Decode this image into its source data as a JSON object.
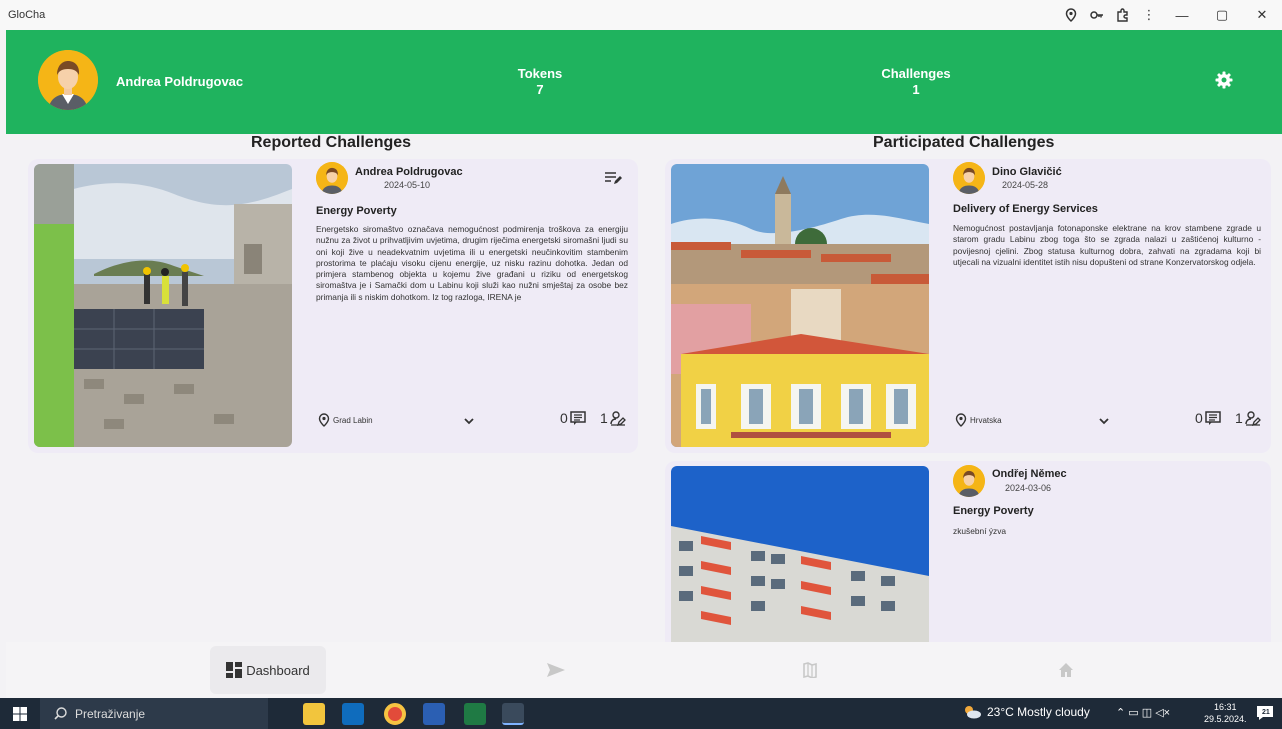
{
  "window": {
    "title": "GloCha",
    "min": "—",
    "max": "▢",
    "close": "✕"
  },
  "header": {
    "user_name": "Andrea Poldrugovac",
    "tokens_label": "Tokens",
    "tokens_value": "7",
    "challenges_label": "Challenges",
    "challenges_value": "1"
  },
  "sections": {
    "reported": "Reported Challenges",
    "participated": "Participated Challenges"
  },
  "reported": [
    {
      "author": "Andrea Poldrugovac",
      "date": "2024-05-10",
      "title": "Energy Poverty",
      "description": "Energetsko siromaštvo označava nemogućnost podmirenja troškova za energiju nužnu za život u prihvatljivim uvjetima, drugim riječima energetski siromašni ljudi su oni koji žive u neadekvatnim uvjetima ili u energetski neučinkovitim stambenim prostorima te plaćaju visoku cijenu energije, uz nisku razinu dohotka. Jedan od primjera stambenog objekta u kojemu žive građani u riziku od energetskog siromaštva je i Samački dom u Labinu koji služi kao nužni smještaj za osobe bez primanja ili s niskim dohotkom. Iz tog razloga, IRENA je",
      "location": "Grad Labin",
      "comments": "0",
      "participants": "1"
    }
  ],
  "participated": [
    {
      "author": "Dino Glavičić",
      "date": "2024-05-28",
      "title": "Delivery of Energy Services",
      "description": "Nemogućnost postavljanja fotonaponske elektrane na krov stambene zgrade u starom gradu Labinu zbog toga što se zgrada nalazi u zaštićenoj kulturno - povijesnoj cjelini. Zbog statusa kulturnog dobra, zahvati na zgradama koji bi utjecali na vizualni identitet istih nisu dopušteni od strane Konzervatorskog odjela.",
      "location": "Hrvatska",
      "comments": "0",
      "participants": "1"
    },
    {
      "author": "Ondřej Němec",
      "date": "2024-03-06",
      "title": "Energy Poverty",
      "description": "zkušební ýzva"
    }
  ],
  "nav": {
    "dashboard": "Dashboard"
  },
  "taskbar": {
    "search_placeholder": "Pretraživanje",
    "weather": "23°C  Mostly cloudy",
    "time": "16:31",
    "date": "29.5.2024.",
    "notif_count": "21"
  },
  "colors": {
    "accent": "#1fb35e",
    "card_bg": "#efebf6",
    "avatar_bg": "#f5b516"
  }
}
